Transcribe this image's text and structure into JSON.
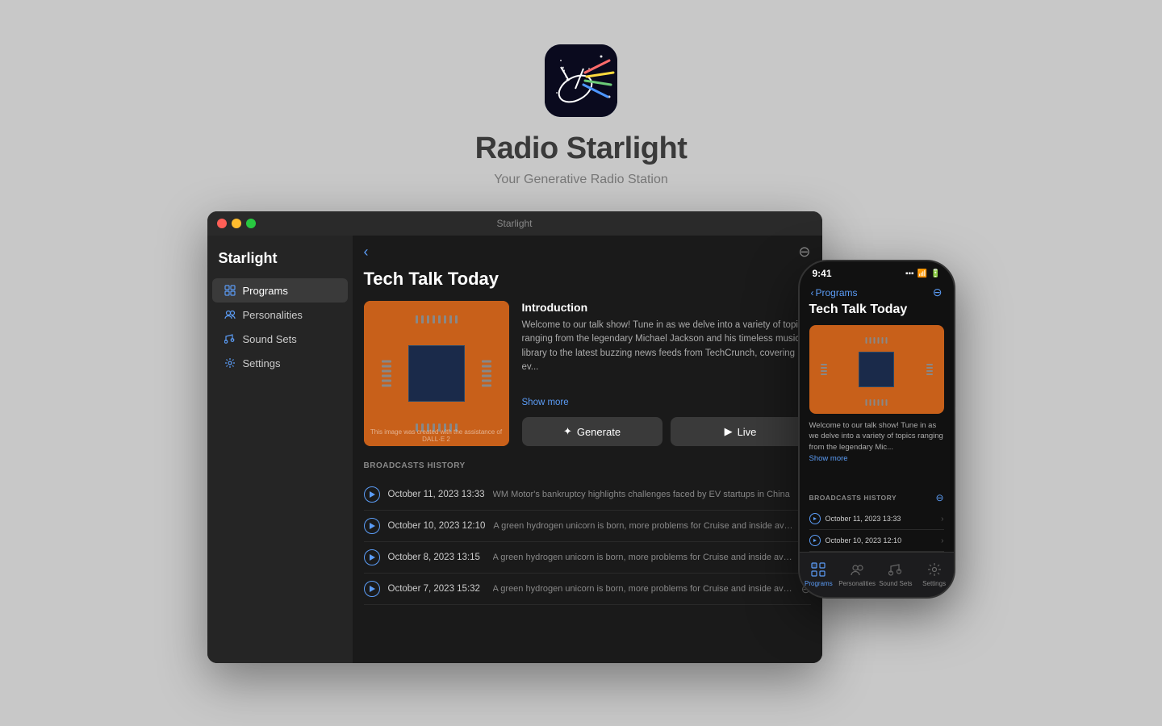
{
  "background_color": "#c8c8c8",
  "accent_color": "#5b9cf6",
  "app": {
    "title": "Radio Starlight",
    "subtitle": "Your Generative Radio Station"
  },
  "window": {
    "title": "Starlight"
  },
  "sidebar": {
    "app_name": "Starlight",
    "items": [
      {
        "id": "programs",
        "label": "Programs",
        "active": true
      },
      {
        "id": "personalities",
        "label": "Personalities",
        "active": false
      },
      {
        "id": "sound-sets",
        "label": "Sound Sets",
        "active": false
      },
      {
        "id": "settings",
        "label": "Settings",
        "active": false
      }
    ]
  },
  "program": {
    "title": "Tech Talk Today",
    "intro_heading": "Introduction",
    "intro_text": "Welcome to our talk show! Tune in as we delve into a variety of topics ranging from the legendary Michael Jackson and his timeless music library to the latest buzzing news feeds from TechCrunch, covering ev...",
    "show_more": "Show more",
    "image_credit": "This image was created with the assistance of DALL·E 2",
    "generate_label": "Generate",
    "live_label": "Live",
    "broadcasts_heading": "BROADCASTS HISTORY"
  },
  "broadcasts": [
    {
      "date": "October 11, 2023  13:33",
      "desc": "WM Motor's bankruptcy highlights challenges faced by EV startups in China"
    },
    {
      "date": "October 10, 2023  12:10",
      "desc": "A green hydrogen unicorn is born, more problems for Cruise and inside aviation's buzz..."
    },
    {
      "date": "October 8, 2023  13:15",
      "desc": "A green hydrogen unicorn is born, more problems for Cruise and inside aviation's buzz..."
    },
    {
      "date": "October 7, 2023  15:32",
      "desc": "A green hydrogen unicorn is born, more problems for Cruise and inside aviation's buzz..."
    }
  ],
  "iphone": {
    "time": "9:41",
    "back_label": "Programs",
    "program_title": "Tech Talk Today",
    "intro_text": "Welcome to our talk show! Tune in as we delve into a variety of topics ranging from the legendary Mic...",
    "show_more": "Show more",
    "broadcasts_heading": "BROADCASTS HISTORY",
    "broadcasts": [
      {
        "date": "October 11, 2023  13:33"
      },
      {
        "date": "October 10, 2023  12:10"
      }
    ],
    "tabs": [
      {
        "id": "programs",
        "label": "Programs",
        "active": true
      },
      {
        "id": "personalities",
        "label": "Personalities",
        "active": false
      },
      {
        "id": "sound-sets",
        "label": "Sound Sets",
        "active": false
      },
      {
        "id": "settings",
        "label": "Settings",
        "active": false
      }
    ]
  }
}
